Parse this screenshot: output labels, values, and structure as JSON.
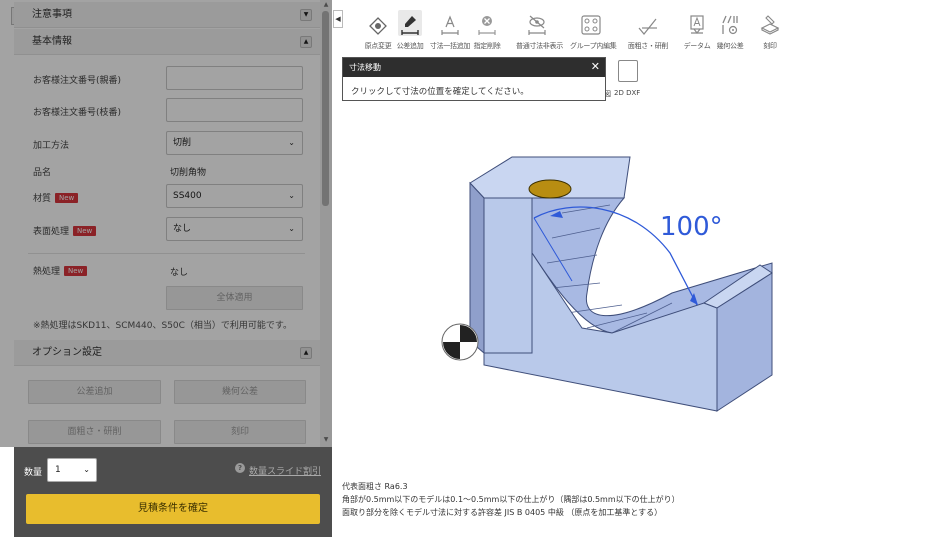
{
  "left_panel": {
    "notes_section": "注意事項",
    "basic_section": "基本情報",
    "fields": {
      "order_main_label": "お客様注文番号(親番)",
      "order_sub_label": "お客様注文番号(枝番)",
      "process_label": "加工方法",
      "process_value": "切削",
      "item_label": "品名",
      "item_value": "切削角物",
      "material_label": "材質",
      "material_value": "SS400",
      "surface_label": "表面処理",
      "surface_value": "なし",
      "heat_label": "熱処理",
      "heat_value": "なし",
      "new_badge": "New"
    },
    "bulk_apply": "全体適用",
    "heat_note": "※熱処理はSKD11、SCM440、S50C（相当）で利用可能です。",
    "options_section": "オプション設定",
    "option_buttons": [
      "公差追加",
      "幾何公差",
      "面粗さ・研削",
      "刻印"
    ],
    "footer": {
      "qty_label": "数量",
      "qty_value": "1",
      "slide_link": "数量スライド割引",
      "confirm": "見積条件を確定"
    }
  },
  "toolbar": {
    "tools": [
      {
        "label": "原点変更",
        "icon": "origin-icon"
      },
      {
        "label": "公差追加",
        "icon": "dimension-add-icon"
      },
      {
        "label": "寸法一括追加",
        "icon": "bulk-dimension-icon"
      },
      {
        "label": "指定削除",
        "icon": "delete-spec-icon"
      },
      {
        "label": "普通寸法非表示",
        "icon": "hide-dimension-icon"
      },
      {
        "label": "グループ内編集",
        "icon": "group-edit-icon"
      },
      {
        "label": "面粗さ・研削",
        "icon": "roughness-icon"
      },
      {
        "label": "データム",
        "icon": "datum-icon"
      },
      {
        "label": "幾何公差",
        "icon": "geometric-tolerance-icon"
      },
      {
        "label": "刻印",
        "icon": "engrave-icon"
      }
    ],
    "row2": {
      "label_left": "図",
      "label_right": "2D DXF"
    }
  },
  "popup": {
    "title": "寸法移動",
    "message": "クリックして寸法の位置を確定してください。"
  },
  "viewer": {
    "dimension_label": "100°",
    "model_color": "#b9c9ea",
    "hole_color": "#b88d12"
  },
  "bottom_notes": [
    "代表面粗さ Ra6.3",
    "角部が0.5mm以下のモデルは0.1～0.5mm以下の仕上がり（隅部は0.5mm以下の仕上がり）",
    "面取り部分を除くモデル寸法に対する許容差 JIS B 0405 中級 （原点を加工基準とする）"
  ]
}
